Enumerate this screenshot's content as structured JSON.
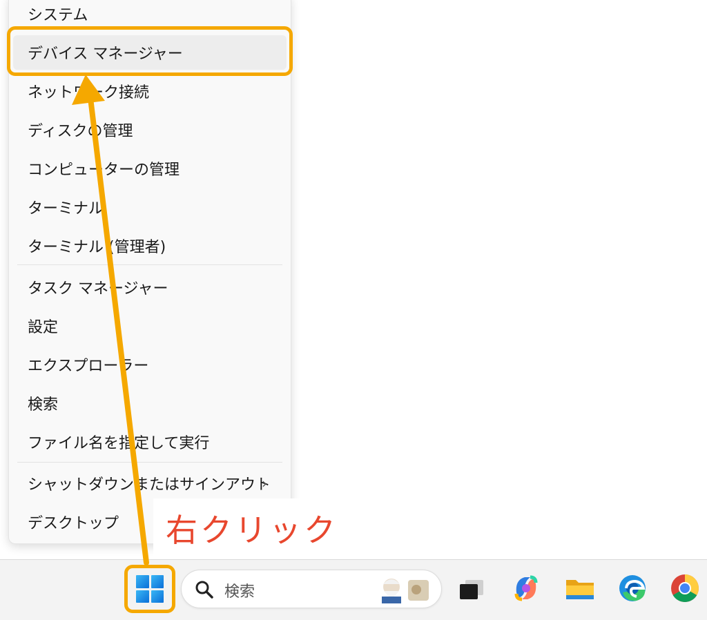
{
  "menu": {
    "items": [
      {
        "label": "システム"
      },
      {
        "label": "デバイス マネージャー"
      },
      {
        "label": "ネットワーク接続"
      },
      {
        "label": "ディスクの管理"
      },
      {
        "label": "コンピューターの管理"
      },
      {
        "label": "ターミナル"
      },
      {
        "label": "ターミナル (管理者)"
      },
      {
        "label": "タスク マネージャー"
      },
      {
        "label": "設定"
      },
      {
        "label": "エクスプローラー"
      },
      {
        "label": "検索"
      },
      {
        "label": "ファイル名を指定して実行"
      },
      {
        "label": "シャットダウンまたはサインアウト"
      },
      {
        "label": "デスクトップ"
      }
    ],
    "chevron": "›"
  },
  "annotation": {
    "text": "右クリック",
    "highlight_color": "#f5a800",
    "text_color": "#e8472e"
  },
  "taskbar": {
    "search_placeholder": "検索",
    "icons": [
      "windows-start-icon",
      "search-icon",
      "task-view-icon",
      "copilot-icon",
      "file-explorer-icon",
      "edge-icon",
      "chrome-icon"
    ]
  }
}
